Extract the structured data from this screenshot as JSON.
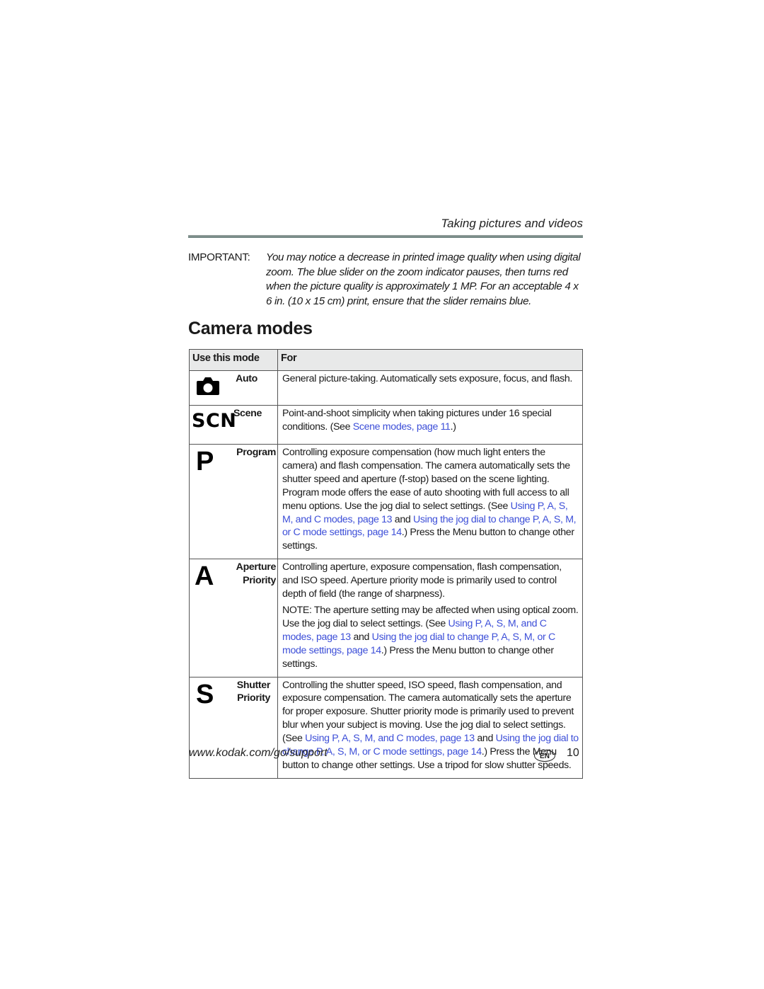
{
  "header": {
    "section_title": "Taking pictures and videos"
  },
  "important": {
    "label": "IMPORTANT:",
    "text": "You may notice a decrease in printed image quality when using digital zoom. The blue slider on the zoom indicator pauses, then turns red when the picture quality is approximately 1 MP. For an acceptable 4 x 6 in. (10 x 15 cm) print, ensure that the slider remains blue."
  },
  "page_title": "Camera modes",
  "table": {
    "headers": [
      "Use this mode",
      "For"
    ],
    "rows": [
      {
        "icon": "camera-icon",
        "mode": "Auto",
        "desc": [
          {
            "t": "General picture-taking. Automatically sets exposure, focus, and flash."
          }
        ]
      },
      {
        "icon": "scn-icon",
        "icon_text": "SCN",
        "mode": "Scene",
        "desc": [
          {
            "t": "Point-and-shoot simplicity when taking pictures under 16 special conditions. (See "
          },
          {
            "t": "Scene modes, page 11",
            "link": true
          },
          {
            "t": ".)"
          }
        ]
      },
      {
        "icon": "program-p-icon",
        "icon_text": "P",
        "mode": "Program",
        "desc": [
          {
            "t": "Controlling exposure compensation (how much light enters the camera) and flash compensation. The camera automatically sets the shutter speed and aperture (f-stop) based on the scene lighting. Program mode offers the ease of auto shooting with full access to all menu options. Use the jog dial to select settings. (See "
          },
          {
            "t": "Using P, A, S, M, and C modes, page 13",
            "link": true
          },
          {
            "t": " and "
          },
          {
            "t": "Using the jog dial to change P, A, S, M, or C mode settings, page 14",
            "link": true
          },
          {
            "t": ".) Press the Menu button to change other settings."
          }
        ]
      },
      {
        "icon": "aperture-a-icon",
        "icon_text": "A",
        "mode": "Aperture Priority",
        "mode_lines": [
          "Aperture",
          "Priority"
        ],
        "desc": [
          {
            "t": "Controlling aperture, exposure compensation, flash compensation, and ISO speed. Aperture priority mode is primarily used to control depth of field (the range of sharpness)."
          }
        ],
        "note": [
          {
            "t": "NOTE: The aperture setting may be affected when using optical zoom. Use the jog dial to select settings. (See "
          },
          {
            "t": "Using P, A, S, M, and C modes, page 13",
            "link": true
          },
          {
            "t": " and "
          },
          {
            "t": "Using the jog dial to change P, A, S, M, or C mode settings, page 14",
            "link": true
          },
          {
            "t": ".) Press the Menu button to change other settings."
          }
        ]
      },
      {
        "icon": "shutter-s-icon",
        "icon_text": "S",
        "mode": "Shutter Priority",
        "mode_lines": [
          "Shutter",
          "Priority"
        ],
        "desc": [
          {
            "t": "Controlling the shutter speed, ISO speed, flash compensation, and exposure compensation. The camera automatically sets the aperture for proper exposure. Shutter priority mode is primarily used to prevent blur when your subject is moving. Use the jog dial to select settings. (See "
          },
          {
            "t": "Using P, A, S, M, and C modes, page 13",
            "link": true
          },
          {
            "t": " and "
          },
          {
            "t": "Using the jog dial to change P, A, S, M, or C mode settings, page 14",
            "link": true
          },
          {
            "t": ".) Press the Menu button to change other settings. Use a tripod for slow shutter speeds."
          }
        ]
      }
    ]
  },
  "footer": {
    "url": "www.kodak.com/go/support",
    "language_badge": "EN",
    "page_number": "10"
  },
  "colors": {
    "link": "#3d4fd8",
    "rule": "#7a8c88",
    "header_bg": "#e8e9e9"
  }
}
